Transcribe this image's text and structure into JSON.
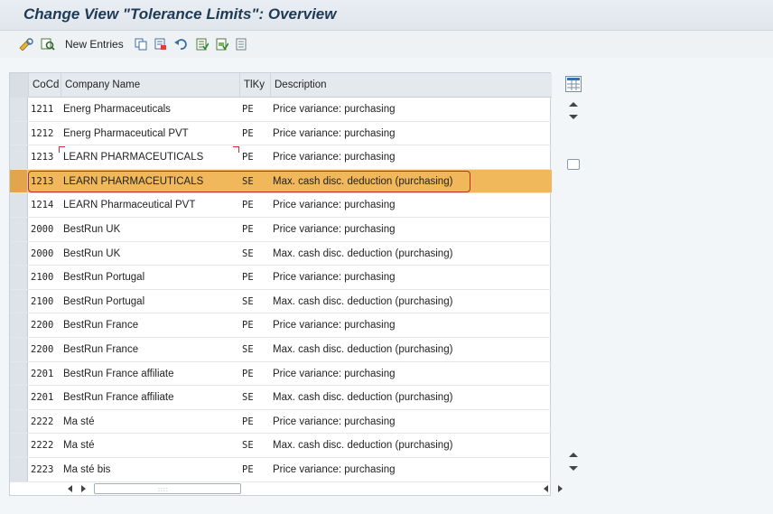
{
  "title": "Change View \"Tolerance Limits\": Overview",
  "toolbar": {
    "new_entries_label": "New Entries",
    "icons": [
      "change-display-icon",
      "details-icon",
      "copy-as-icon",
      "delete-icon",
      "undo-change-icon",
      "select-all-icon",
      "select-block-icon",
      "deselect-all-icon"
    ]
  },
  "table": {
    "columns": [
      "CoCd",
      "Company Name",
      "TlKy",
      "Description"
    ],
    "rows": [
      {
        "cocd": "1211",
        "company": "Energ Pharmaceuticals",
        "tlky": "PE",
        "description": "Price variance: purchasing"
      },
      {
        "cocd": "1212",
        "company": "Energ Pharmaceutical PVT",
        "tlky": "PE",
        "description": "Price variance: purchasing"
      },
      {
        "cocd": "1213",
        "company": "LEARN PHARMACEUTICALS",
        "tlky": "PE",
        "description": "Price variance: purchasing"
      },
      {
        "cocd": "1213",
        "company": "LEARN PHARMACEUTICALS",
        "tlky": "SE",
        "description": "Max. cash disc. deduction (purchasing)"
      },
      {
        "cocd": "1214",
        "company": "LEARN Pharmaceutical PVT",
        "tlky": "PE",
        "description": "Price variance: purchasing"
      },
      {
        "cocd": "2000",
        "company": "BestRun UK",
        "tlky": "PE",
        "description": "Price variance: purchasing"
      },
      {
        "cocd": "2000",
        "company": "BestRun UK",
        "tlky": "SE",
        "description": "Max. cash disc. deduction (purchasing)"
      },
      {
        "cocd": "2100",
        "company": "BestRun Portugal",
        "tlky": "PE",
        "description": "Price variance: purchasing"
      },
      {
        "cocd": "2100",
        "company": "BestRun Portugal",
        "tlky": "SE",
        "description": "Max. cash disc. deduction (purchasing)"
      },
      {
        "cocd": "2200",
        "company": "BestRun France",
        "tlky": "PE",
        "description": "Price variance: purchasing"
      },
      {
        "cocd": "2200",
        "company": "BestRun France",
        "tlky": "SE",
        "description": "Max. cash disc. deduction (purchasing)"
      },
      {
        "cocd": "2201",
        "company": "BestRun France affiliate",
        "tlky": "PE",
        "description": "Price variance: purchasing"
      },
      {
        "cocd": "2201",
        "company": "BestRun France affiliate",
        "tlky": "SE",
        "description": "Max. cash disc. deduction (purchasing)"
      },
      {
        "cocd": "2222",
        "company": "Ma sté",
        "tlky": "PE",
        "description": "Price variance: purchasing"
      },
      {
        "cocd": "2222",
        "company": "Ma sté",
        "tlky": "SE",
        "description": "Max. cash disc. deduction (purchasing)"
      },
      {
        "cocd": "2223",
        "company": "Ma sté bis",
        "tlky": "PE",
        "description": "Price variance: purchasing"
      }
    ],
    "selected_row": 3,
    "editing_row": 2
  },
  "colors": {
    "selected_row": "#f0b85a",
    "selection_outline": "#b5312a",
    "title_text": "#1f3a55"
  }
}
